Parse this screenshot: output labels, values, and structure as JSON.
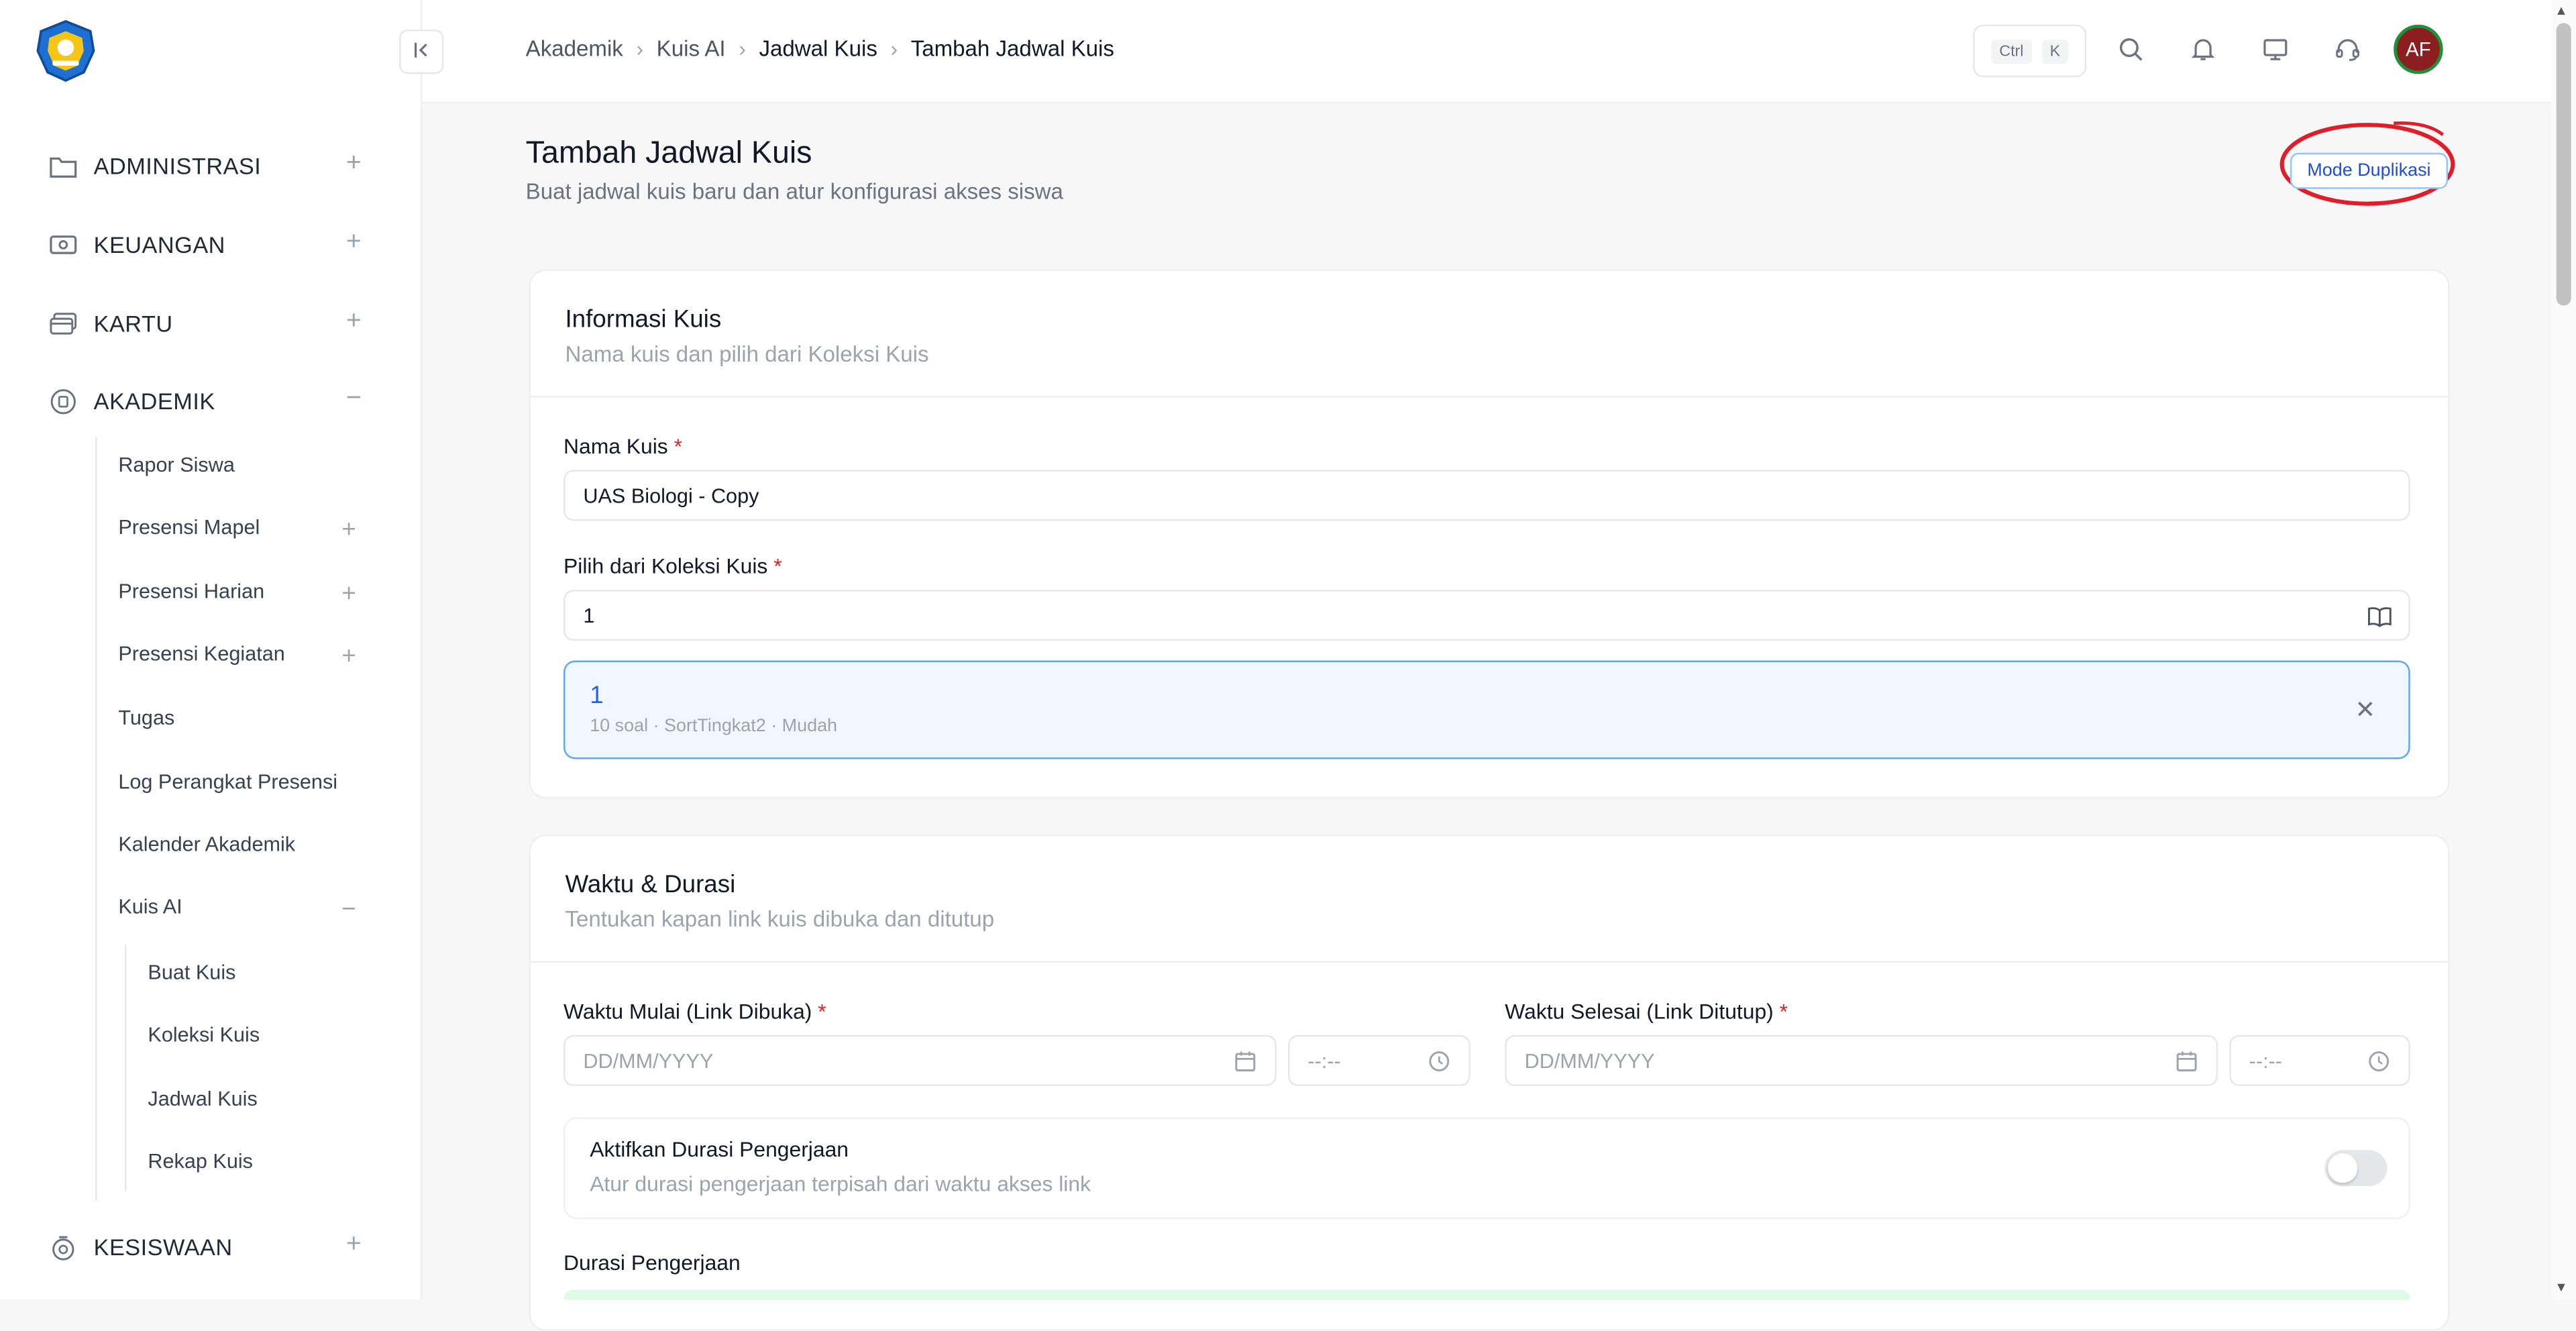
{
  "sidebar": {
    "groups": [
      {
        "label": "ADMINISTRASI",
        "toggle": "+",
        "icon": "folder-icon"
      },
      {
        "label": "KEUANGAN",
        "toggle": "+",
        "icon": "money-icon"
      },
      {
        "label": "KARTU",
        "toggle": "+",
        "icon": "card-icon"
      },
      {
        "label": "AKADEMIK",
        "toggle": "−",
        "icon": "academic-icon"
      },
      {
        "label": "KESISWAAN",
        "toggle": "+",
        "icon": "student-icon"
      }
    ],
    "akademik_items": [
      {
        "label": "Rapor Siswa",
        "toggle": ""
      },
      {
        "label": "Presensi Mapel",
        "toggle": "+"
      },
      {
        "label": "Presensi Harian",
        "toggle": "+"
      },
      {
        "label": "Presensi Kegiatan",
        "toggle": "+"
      },
      {
        "label": "Tugas",
        "toggle": ""
      },
      {
        "label": "Log Perangkat Presensi",
        "toggle": ""
      },
      {
        "label": "Kalender Akademik",
        "toggle": ""
      },
      {
        "label": "Kuis AI",
        "toggle": "−"
      }
    ],
    "kuis_items": [
      "Buat Kuis",
      "Koleksi Kuis",
      "Jadwal Kuis",
      "Rekap Kuis"
    ]
  },
  "header": {
    "breadcrumb": [
      "Akademik",
      "Kuis AI",
      "Jadwal Kuis",
      "Tambah Jadwal Kuis"
    ],
    "shortcut": [
      "Ctrl",
      "K"
    ],
    "avatar_initials": "AF"
  },
  "page": {
    "title": "Tambah Jadwal Kuis",
    "subtitle": "Buat jadwal kuis baru dan atur konfigurasi akses siswa",
    "mode_button": "Mode Duplikasi"
  },
  "info_card": {
    "title": "Informasi Kuis",
    "subtitle": "Nama kuis dan pilih dari Koleksi Kuis",
    "name_label": "Nama Kuis",
    "name_value": "UAS Biologi - Copy",
    "collection_label": "Pilih dari Koleksi Kuis",
    "collection_value": "1",
    "selected": {
      "title": "1",
      "meta": "10 soal · SortTingkat2 · Mudah"
    },
    "required_mark": "*"
  },
  "time_card": {
    "title": "Waktu & Durasi",
    "subtitle": "Tentukan kapan link kuis dibuka dan ditutup",
    "start_label": "Waktu Mulai (Link Dibuka)",
    "end_label": "Waktu Selesai (Link Ditutup)",
    "date_placeholder": "DD/MM/YYYY",
    "time_placeholder": "--:--",
    "duration_toggle_title": "Aktifkan Durasi Pengerjaan",
    "duration_toggle_sub": "Atur durasi pengerjaan terpisah dari waktu akses link",
    "duration_toggle_on": false,
    "duration_label": "Durasi Pengerjaan"
  }
}
